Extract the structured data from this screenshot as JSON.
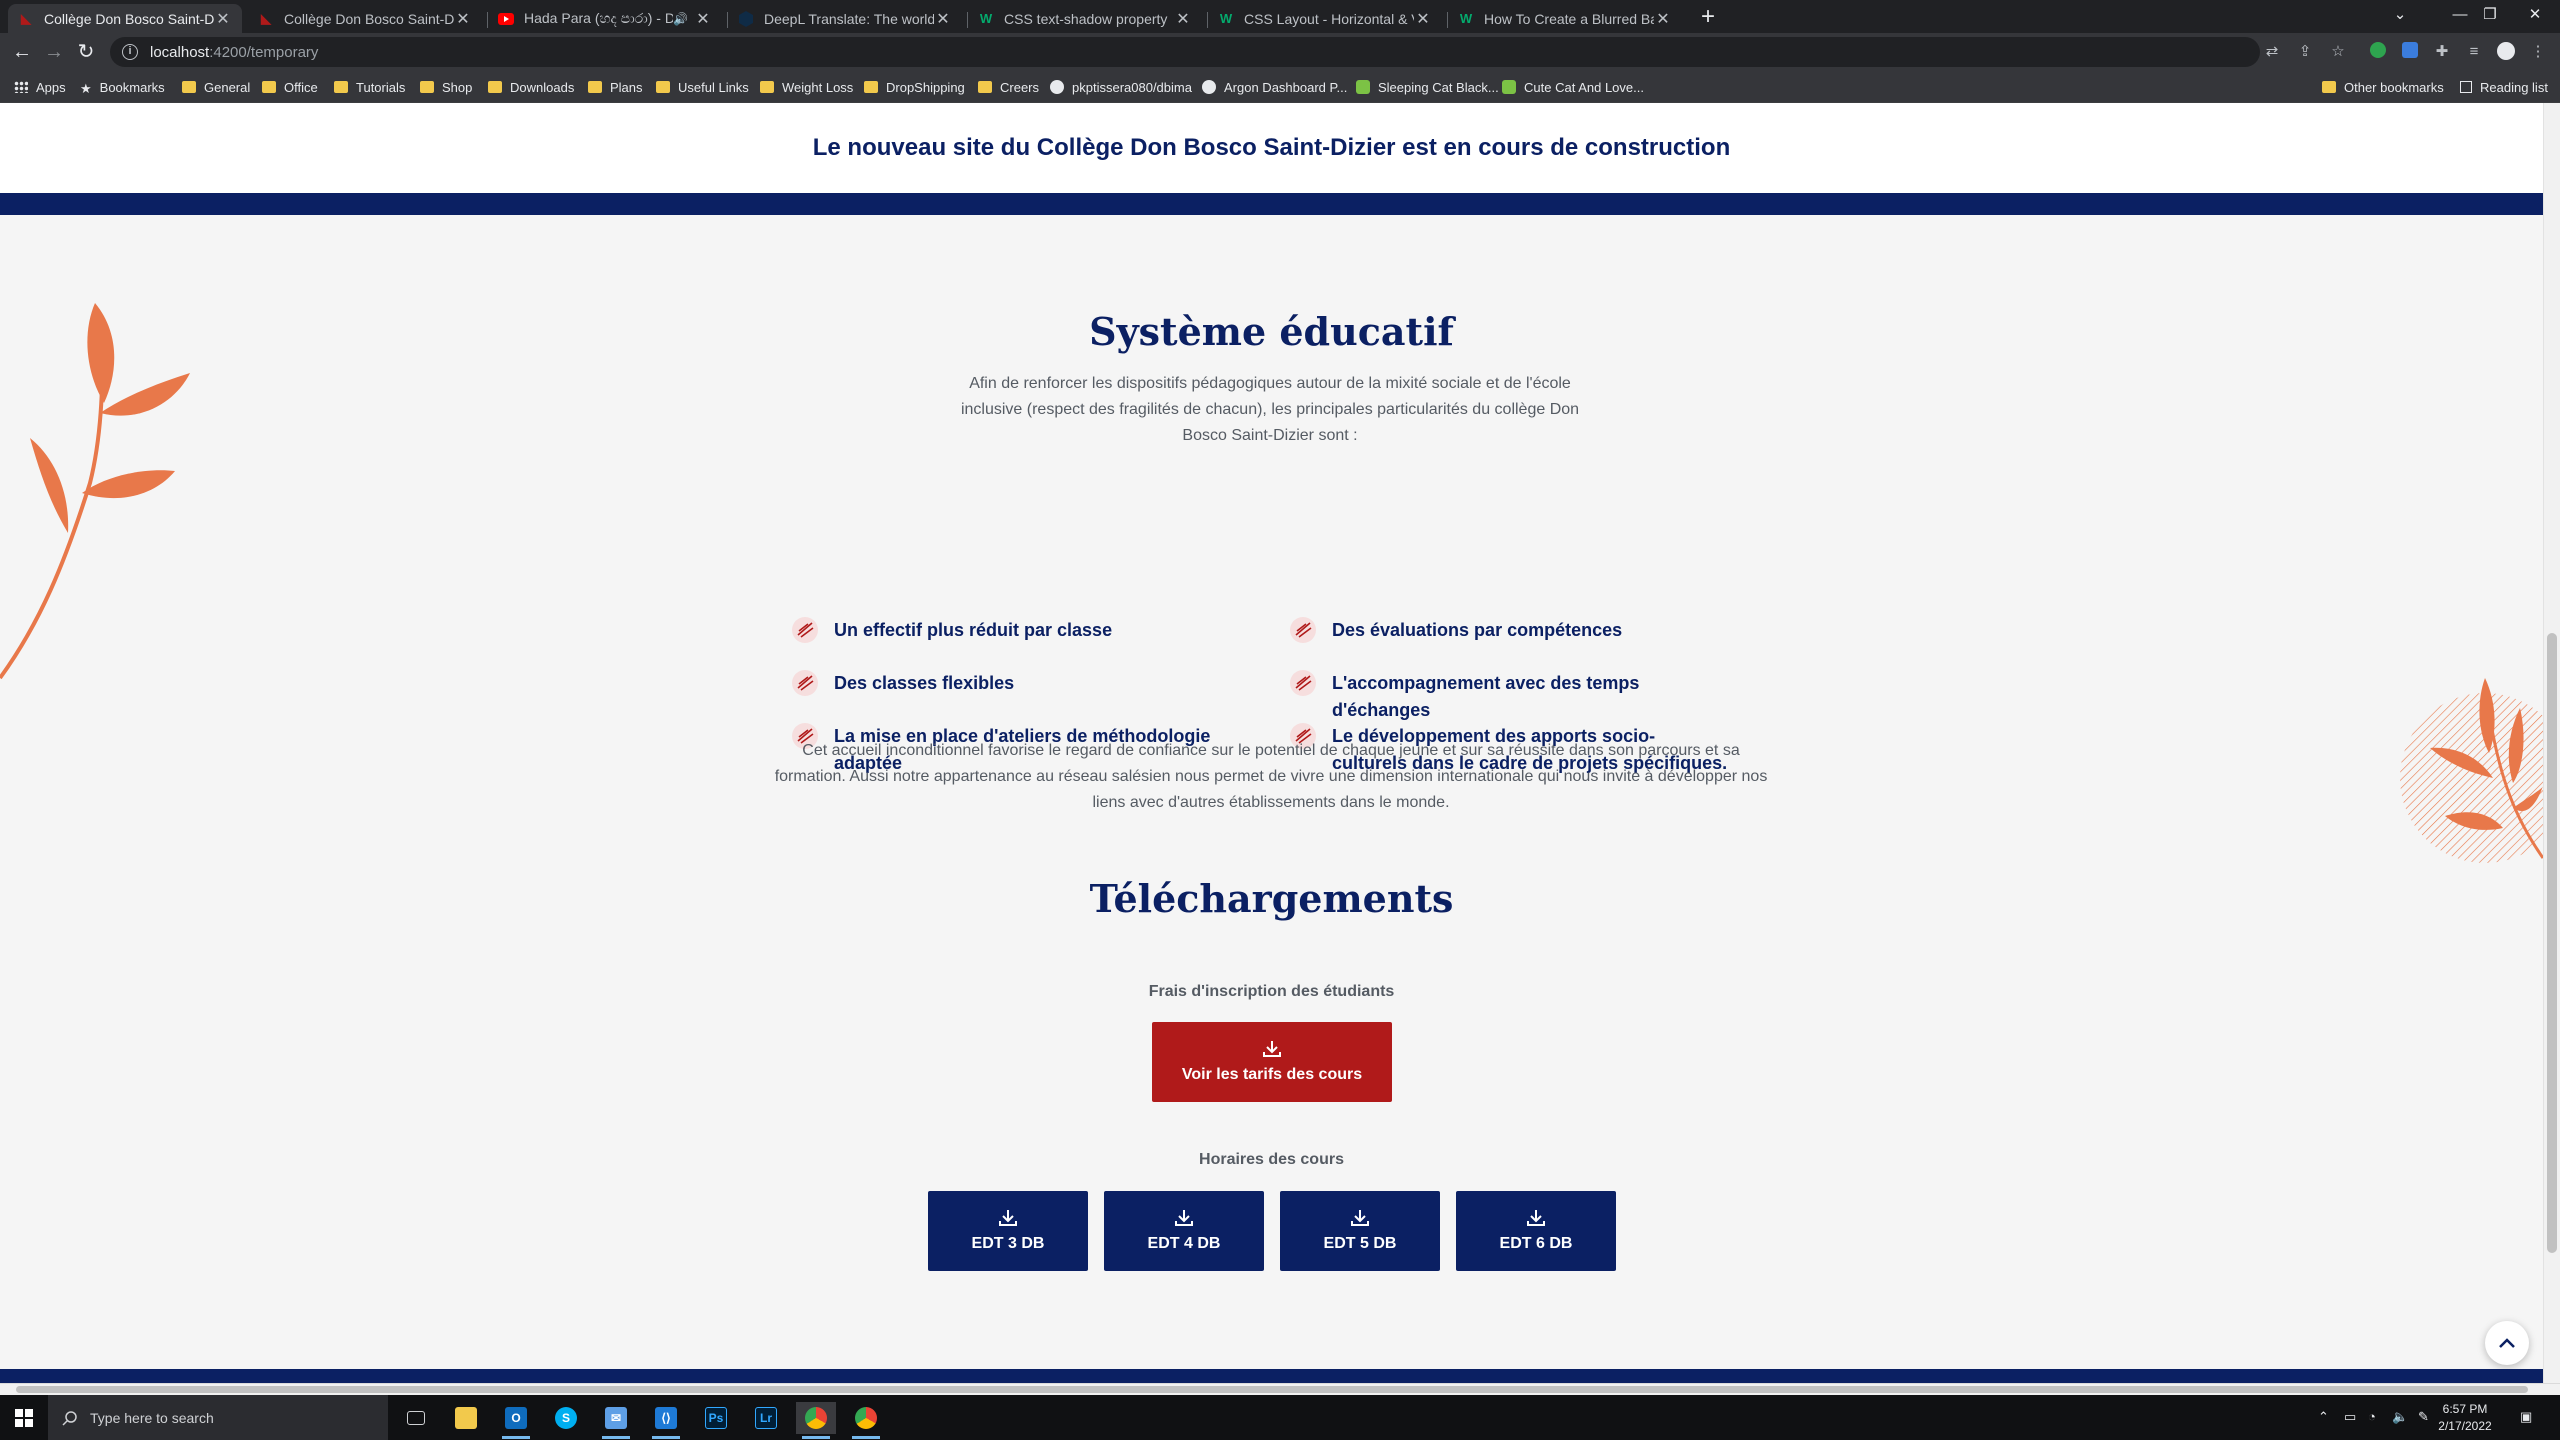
{
  "browser": {
    "tabs": [
      {
        "title": "Collège Don Bosco Saint-Dizier",
        "active": true,
        "icon": "college-favicon"
      },
      {
        "title": "Collège Don Bosco Saint-Dizier",
        "active": false,
        "icon": "college-favicon"
      },
      {
        "title": "Hada Para (හද පාරා) - Dhy",
        "active": false,
        "icon": "youtube-favicon"
      },
      {
        "title": "DeepL Translate: The world's mo",
        "active": false,
        "icon": "deepl-favicon"
      },
      {
        "title": "CSS text-shadow property",
        "active": false,
        "icon": "w3schools-favicon"
      },
      {
        "title": "CSS Layout - Horizontal & Vertic",
        "active": false,
        "icon": "w3schools-favicon"
      },
      {
        "title": "How To Create a Blurred Backgr",
        "active": false,
        "icon": "w3schools-favicon"
      }
    ],
    "address": {
      "host": "localhost",
      "path": ":4200/temporary"
    },
    "bookmarks": [
      {
        "label": "Apps",
        "icon": "apps-grid-icon"
      },
      {
        "label": "Bookmarks",
        "icon": "star-icon"
      },
      {
        "label": "General",
        "icon": "folder-icon"
      },
      {
        "label": "Office",
        "icon": "folder-icon"
      },
      {
        "label": "Tutorials",
        "icon": "folder-icon"
      },
      {
        "label": "Shop",
        "icon": "folder-icon"
      },
      {
        "label": "Downloads",
        "icon": "folder-icon"
      },
      {
        "label": "Plans",
        "icon": "folder-icon"
      },
      {
        "label": "Useful Links",
        "icon": "folder-icon"
      },
      {
        "label": "Weight Loss",
        "icon": "folder-icon"
      },
      {
        "label": "DropShipping",
        "icon": "folder-icon"
      },
      {
        "label": "Creers",
        "icon": "folder-icon"
      },
      {
        "label": "pkptissera080/dbima",
        "icon": "github-icon"
      },
      {
        "label": "Argon Dashboard P...",
        "icon": "argon-icon"
      },
      {
        "label": "Sleeping Cat Black...",
        "icon": "green-site-icon"
      },
      {
        "label": "Cute Cat And Love...",
        "icon": "green-site-icon"
      }
    ],
    "other_bookmarks": "Other bookmarks",
    "reading_list": "Reading list"
  },
  "page": {
    "banner": "Le nouveau site du Collège Don Bosco Saint-Dizier est en cours de construction",
    "systeme": {
      "title": "Système éducatif",
      "intro": "Afin de renforcer les dispositifs pédagogiques autour de la mixité sociale et de l'école inclusive (respect des fragilités de chacun), les principales particularités du collège Don Bosco Saint-Dizier sont :",
      "features_left": [
        "Un effectif plus réduit par classe",
        "Des classes flexibles",
        "La mise en place d'ateliers de méthodologie adaptée"
      ],
      "features_right": [
        "Des évaluations par compétences",
        "L'accompagnement avec des temps d'échanges",
        "Le développement des apports socio-culturels dans le cadre de projets spécifiques."
      ],
      "outro": "Cet accueil inconditionnel favorise le regard de confiance sur le potentiel de chaque jeune et sur sa réussite dans son parcours et sa formation. Aussi notre appartenance au réseau salésien nous permet de vivre une dimension internationale qui nous invite à développer nos liens avec d'autres établissements dans le monde."
    },
    "telechargements": {
      "title": "Téléchargements",
      "fees_label": "Frais d'inscription des étudiants",
      "fees_button": "Voir les tarifs des cours",
      "schedule_label": "Horaires des cours",
      "schedule_buttons": [
        "EDT 3 DB",
        "EDT 4 DB",
        "EDT 5 DB",
        "EDT 6 DB"
      ]
    },
    "colors": {
      "navy": "#0b2063",
      "red": "#b01a1a",
      "orange": "#e8784a",
      "text_gray": "#555b63"
    }
  },
  "taskbar": {
    "search_placeholder": "Type here to search",
    "time": "6:57 PM",
    "date": "2/17/2022"
  }
}
